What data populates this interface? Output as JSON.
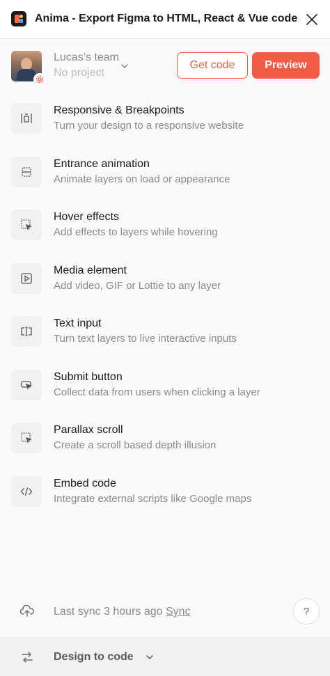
{
  "window": {
    "title": "Anima - Export Figma to HTML, React & Vue code",
    "logo_icon": "anima-logo-icon",
    "close_icon": "close-icon"
  },
  "header": {
    "team_name": "Lucas’s team",
    "project_name": "No project",
    "get_code_label": "Get code",
    "preview_label": "Preview",
    "accent_color": "#f25c44"
  },
  "features": [
    {
      "icon": "breakpoints-icon",
      "title": "Responsive & Breakpoints",
      "subtitle": "Turn your design to a responsive website"
    },
    {
      "icon": "entrance-animation-icon",
      "title": "Entrance animation",
      "subtitle": "Animate layers on load or appearance"
    },
    {
      "icon": "hover-cursor-icon",
      "title": "Hover effects",
      "subtitle": "Add effects to layers while hovering"
    },
    {
      "icon": "play-icon",
      "title": "Media element",
      "subtitle": "Add video, GIF or Lottie to any layer"
    },
    {
      "icon": "text-input-icon",
      "title": "Text input",
      "subtitle": "Turn text layers to live interactive inputs"
    },
    {
      "icon": "submit-button-icon",
      "title": "Submit button",
      "subtitle": "Collect data from users when clicking a layer"
    },
    {
      "icon": "parallax-icon",
      "title": "Parallax scroll",
      "subtitle": "Create a scroll based depth illusion"
    },
    {
      "icon": "code-icon",
      "title": "Embed code",
      "subtitle": "Integrate external scripts like Google maps"
    }
  ],
  "footer": {
    "sync_status": "Last sync 3 hours ago",
    "sync_link": "Sync",
    "help_label": "?",
    "mode_label": "Design to code"
  }
}
